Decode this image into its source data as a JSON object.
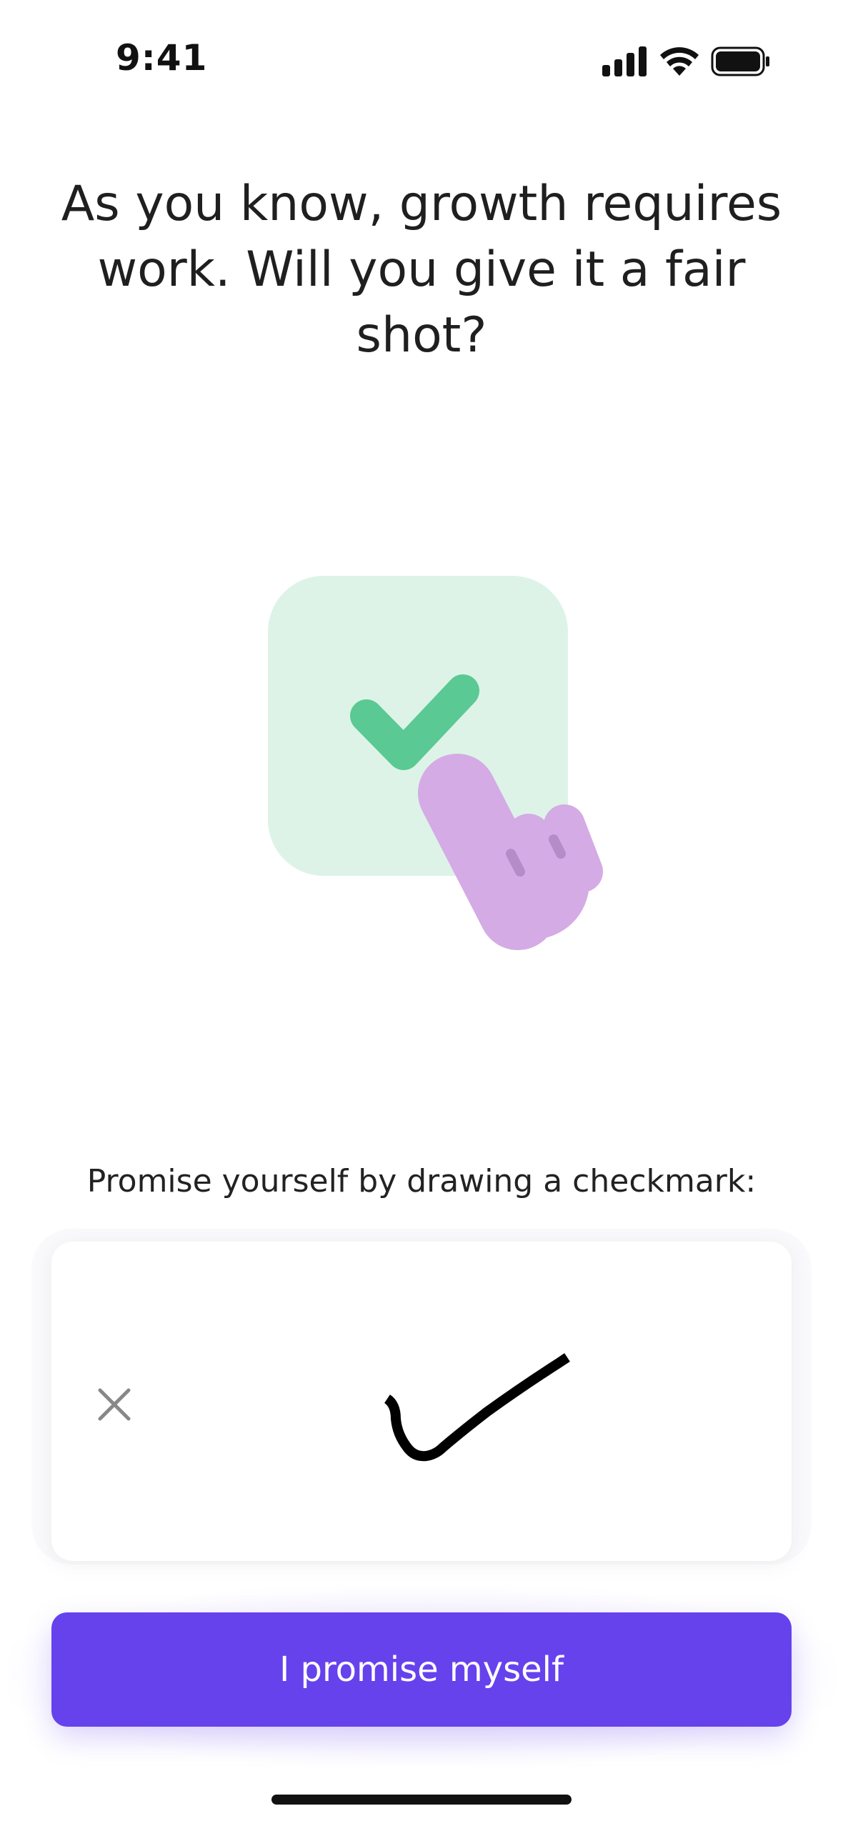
{
  "status_bar": {
    "time": "9:41",
    "icons": [
      "cellular-signal-icon",
      "wifi-icon",
      "battery-icon"
    ]
  },
  "screen": {
    "title": "As you know, growth requires work. Will you give it a fair shot?",
    "illustration": {
      "icon": "checkbox-hand-icon",
      "colors": {
        "card": "#DDF3E8",
        "check": "#5AC993",
        "hand": "#D4ABE4",
        "hand_detail": "#B78BC8"
      }
    },
    "prompt": "Promise yourself by drawing a checkmark:",
    "drawing_pad": {
      "clear_icon": "close-icon",
      "has_drawing": true
    },
    "primary_button": {
      "label": "I promise myself",
      "color": "#6642ED"
    }
  }
}
